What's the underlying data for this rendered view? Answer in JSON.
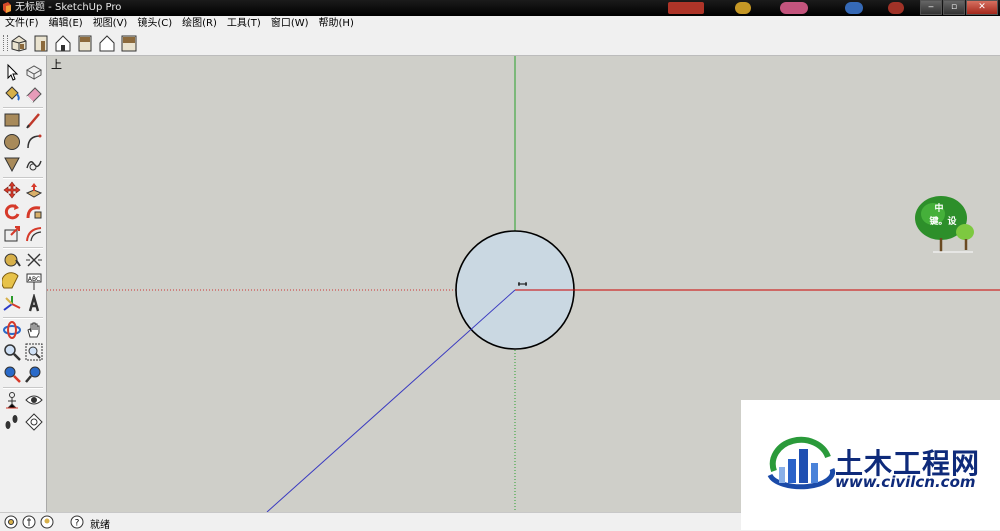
{
  "window": {
    "title": "无标题 - SketchUp Pro",
    "app_icon": "sketchup-logo-icon"
  },
  "menu": [
    {
      "label": "文件(F)"
    },
    {
      "label": "编辑(E)"
    },
    {
      "label": "视图(V)"
    },
    {
      "label": "镜头(C)"
    },
    {
      "label": "绘图(R)"
    },
    {
      "label": "工具(T)"
    },
    {
      "label": "窗口(W)"
    },
    {
      "label": "帮助(H)"
    }
  ],
  "views_toolbar": [
    "iso-view-icon",
    "front-view-icon",
    "house-view-icon",
    "back-view-icon",
    "side-view-icon",
    "top-view-icon"
  ],
  "tools": [
    [
      "select-icon",
      "make-component-icon"
    ],
    [
      "paint-bucket-icon",
      "eraser-icon"
    ],
    [
      "rectangle-icon",
      "line-icon"
    ],
    [
      "circle-icon",
      "arc-icon"
    ],
    [
      "polygon-icon",
      "freehand-icon"
    ],
    [
      "move-icon",
      "push-pull-icon"
    ],
    [
      "rotate-icon",
      "follow-me-icon"
    ],
    [
      "scale-icon",
      "offset-icon"
    ],
    [
      "tape-measure-icon",
      "dimension-icon"
    ],
    [
      "protractor-icon",
      "text-icon"
    ],
    [
      "axes-icon",
      "3d-text-icon"
    ],
    [
      "orbit-icon",
      "pan-icon"
    ],
    [
      "zoom-icon",
      "zoom-window-icon"
    ],
    [
      "zoom-extents-icon",
      "previous-view-icon"
    ],
    [
      "position-camera-icon",
      "look-around-icon"
    ],
    [
      "walk-icon",
      "section-plane-icon"
    ]
  ],
  "viewport": {
    "view_label": "上",
    "background": "#cfcfc9",
    "circle_fill": "#cad8e2"
  },
  "tree_logo": {
    "line1": "中",
    "line2": "键。设"
  },
  "status": {
    "text": "就绪",
    "icons": [
      "geo-location-icon",
      "credits-icon",
      "user-icon",
      "help-icon"
    ]
  },
  "watermark": {
    "name": "土木工程网",
    "url": "www.civilcn.com",
    "color": "#0e2a7a"
  }
}
